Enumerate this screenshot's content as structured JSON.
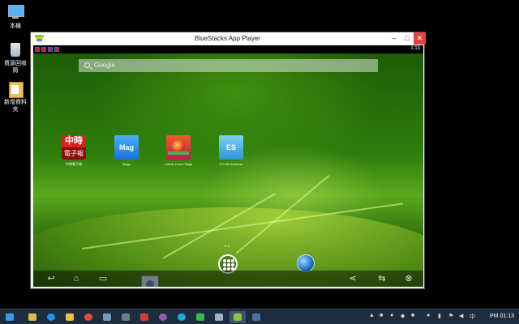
{
  "desktop": {
    "icons": [
      {
        "label": "本機"
      },
      {
        "label": "資源回收筒"
      },
      {
        "label": "新增資料夾"
      }
    ]
  },
  "window": {
    "title": "BlueStacks App Player",
    "controls": {
      "minimize": "–",
      "maximize": "□",
      "close": "✕"
    }
  },
  "android": {
    "status": {
      "time": "1:13"
    },
    "search": {
      "placeholder": "Google"
    },
    "apps": [
      {
        "name": "中時電子報",
        "icon_top": "中時",
        "icon_bottom": "電子報",
        "label": "中時電子報"
      },
      {
        "name": "Magv",
        "icon_text": "Mag",
        "label": "Magv"
      },
      {
        "name": "Candy Crush Saga",
        "label": "Candy Crush Saga"
      },
      {
        "name": "ES File Explorer",
        "icon_text": "ES",
        "label": "ES File Explorer"
      }
    ],
    "page_dots": "• •",
    "nav": {
      "back": "↩",
      "home": "⌂",
      "recents": "▭",
      "share": "⋖",
      "rotate": "⇆",
      "close": "⊗"
    }
  },
  "taskbar": {
    "clock": "PM 01:13",
    "colors": {
      "bg": "#1e2d3e",
      "accent": "#3d9ae8"
    }
  }
}
